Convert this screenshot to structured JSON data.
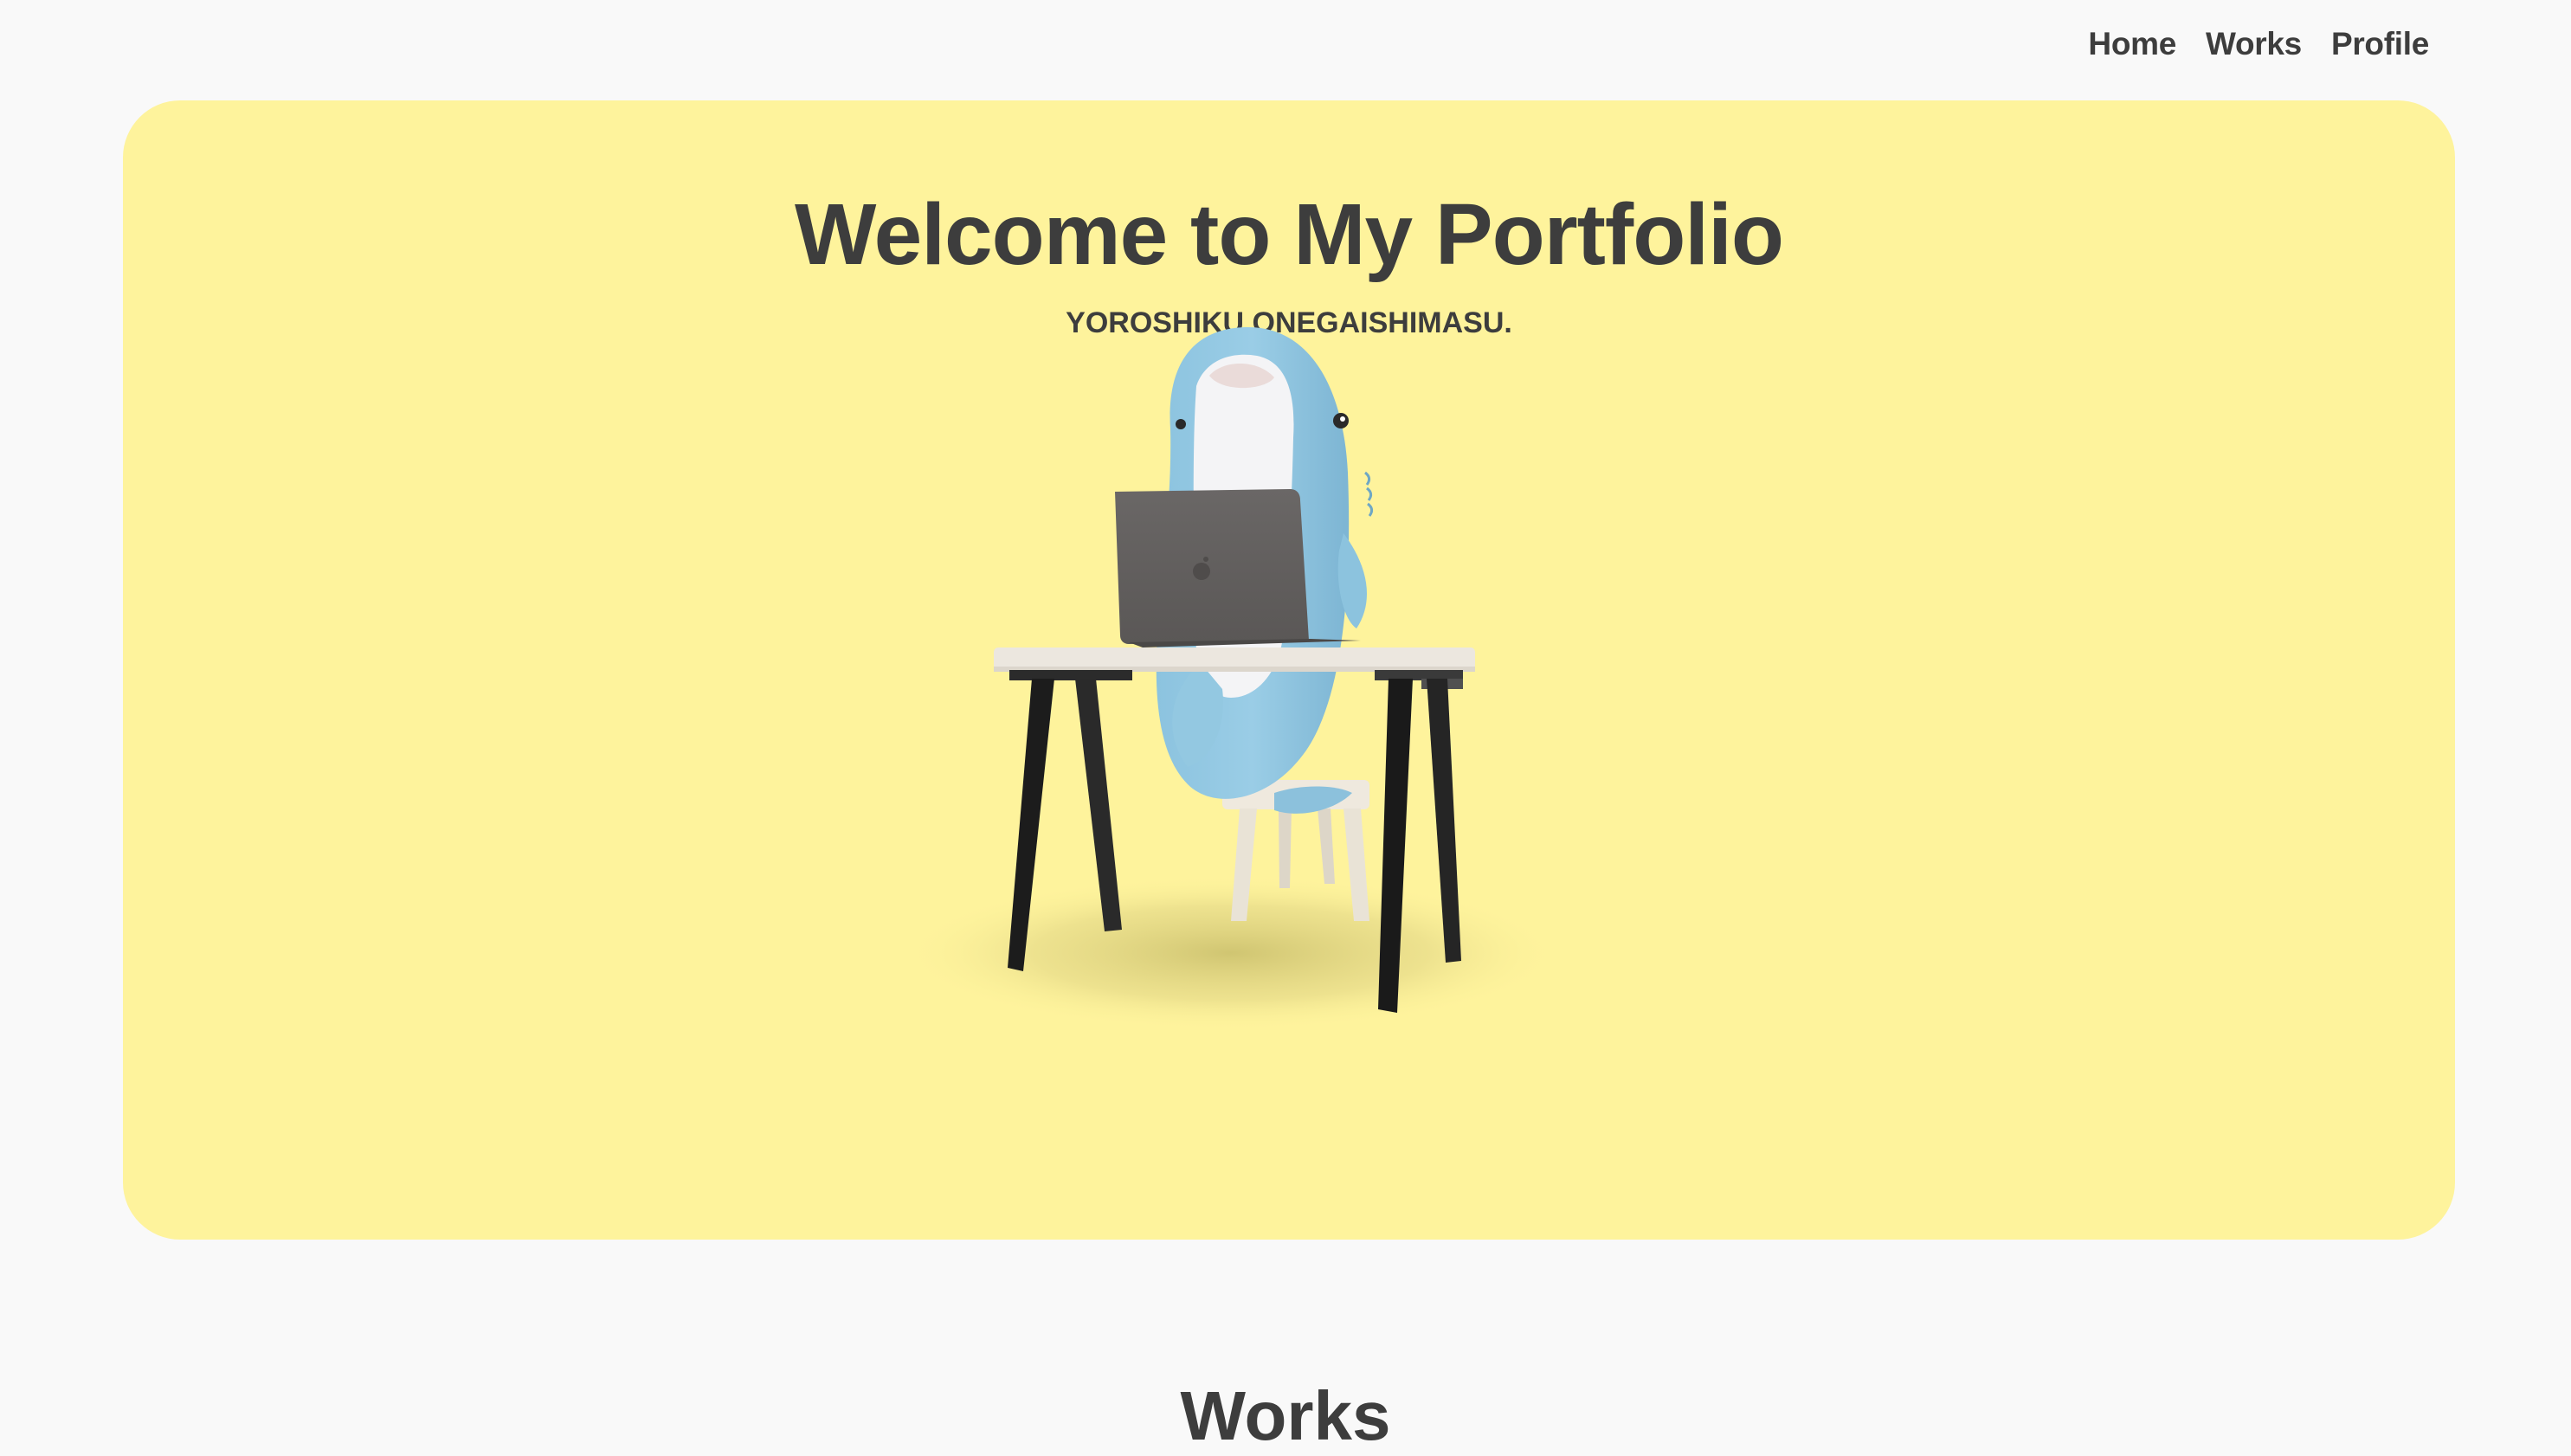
{
  "nav": {
    "items": [
      {
        "label": "Home"
      },
      {
        "label": "Works"
      },
      {
        "label": "Profile"
      }
    ]
  },
  "hero": {
    "title": "Welcome to My Portfolio",
    "subtitle": "YOROSHIKU ONEGAISHIMASU.",
    "illustration": "shark-plush-at-desk-with-laptop",
    "background_color": "#fef39c"
  },
  "sections": {
    "works_heading": "Works"
  },
  "colors": {
    "page_background": "#f9f9f9",
    "text": "#3d3d3d",
    "accent": "#fef39c"
  }
}
